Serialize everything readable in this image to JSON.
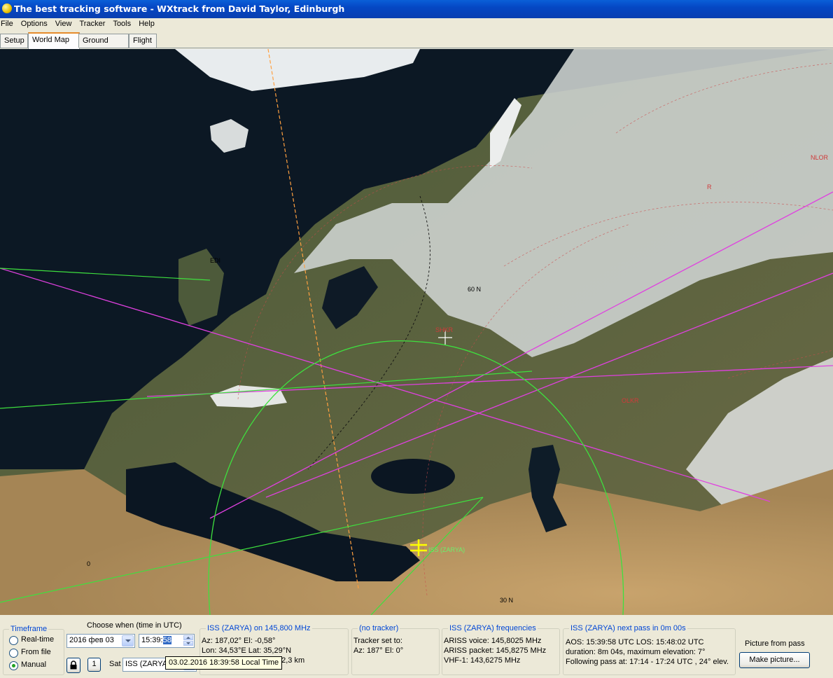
{
  "window": {
    "title": "The best tracking software - WXtrack from David Taylor, Edinburgh"
  },
  "menu": [
    "File",
    "Options",
    "View",
    "Tracker",
    "Tools",
    "Help"
  ],
  "tabs": {
    "setup": "Setup",
    "world_map": "World Map",
    "ground_path": "Ground Path",
    "flight": "Flight"
  },
  "map": {
    "stations": {
      "edi": "EDI",
      "shkr": "SHKR",
      "s1": "NLOR",
      "s2": "R",
      "s3": "OLKR"
    },
    "satellite_label": "ISS (ZARYA)",
    "grid_labels": {
      "lat60": "60 N",
      "lat30": "30 N",
      "lon0": "0"
    }
  },
  "timeframe": {
    "label": "Timeframe",
    "realtime": "Real-time",
    "from_file": "From file",
    "manual": "Manual",
    "selected": "manual"
  },
  "choose": {
    "label": "Choose when (time in UTC)",
    "date": "2016 фев 03",
    "time_prefix": "15:39:",
    "time_selected": "58",
    "counter": "1",
    "sat_label": "Sat",
    "sat_value": "ISS (ZARYA)"
  },
  "tooltip": {
    "text": "03.02.2016 18:39:58  Local Time"
  },
  "sat_info": {
    "label": "ISS (ZARYA) on 145,800 MHz",
    "line1": "Az: 187,02°  El: -0,58°",
    "line2": "Lon: 34,53°E  Lat: 35,29°N",
    "line3_tail": "02,3 km"
  },
  "tracker": {
    "label": "(no tracker)",
    "line1": "Tracker set to:",
    "line2": "Az: 187°  El: 0°"
  },
  "frequencies": {
    "label": "ISS (ZARYA) frequencies",
    "line1": "ARISS voice:  145,8025 MHz",
    "line2": "ARISS packet:  145,8275 MHz",
    "line3": "VHF-1:  143,6275 MHz"
  },
  "next_pass": {
    "label": "ISS (ZARYA) next pass in 0m 00s",
    "line1": "AOS: 15:39:58 UTC  LOS: 15:48:02 UTC",
    "line2": "duration: 8m 04s,  maximum elevation: 7°",
    "line3": "Following pass at: 17:14 - 17:24 UTC , 24° elev."
  },
  "picture": {
    "label": "Picture from pass",
    "button": "Make picture..."
  }
}
